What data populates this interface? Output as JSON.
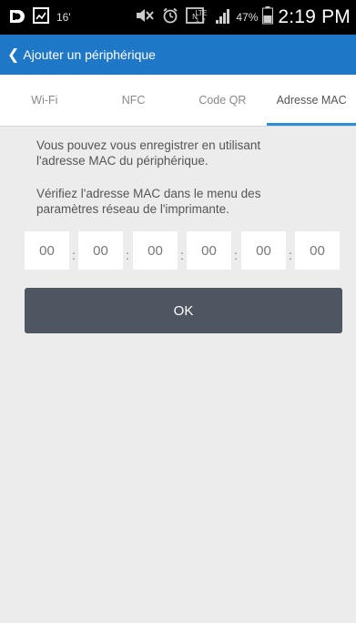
{
  "status_bar": {
    "notification_count": "16'",
    "battery_percent": "47%",
    "network": "LTE",
    "time": "2:19 PM"
  },
  "app_bar": {
    "back_chevron": "❮",
    "title": "Ajouter un périphérique"
  },
  "tabs": [
    {
      "label": "Wi-Fi",
      "active": false
    },
    {
      "label": "NFC",
      "active": false
    },
    {
      "label": "Code QR",
      "active": false
    },
    {
      "label": "Adresse MAC",
      "active": true
    }
  ],
  "content": {
    "description_1": "Vous pouvez vous enregistrer en utilisant l'adresse MAC du périphérique.",
    "description_2": "Vérifiez l'adresse MAC dans le menu des paramètres réseau de l'imprimante.",
    "mac_fields": [
      "00",
      "00",
      "00",
      "00",
      "00",
      "00"
    ],
    "mac_separator": ":",
    "ok_label": "OK"
  },
  "colors": {
    "app_bar": "#1f78c7",
    "tab_indicator": "#2a8fd8",
    "ok_button": "#4e5661",
    "background": "#ececec"
  },
  "icons": [
    "notification-app-icon",
    "image-icon",
    "mute-icon",
    "alarm-icon",
    "nfc-icon",
    "lte-icon",
    "signal-icon",
    "battery-icon"
  ]
}
